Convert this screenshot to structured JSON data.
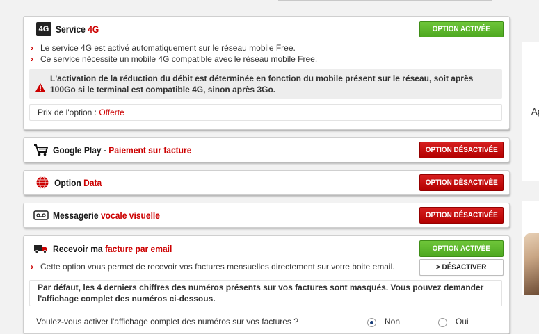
{
  "service4g": {
    "badge": "4G",
    "title_a": "Service ",
    "title_b": "4G",
    "status": "OPTION ACTIVÉE",
    "bullets": [
      "Le service 4G est activé automatiquement sur le réseau mobile Free.",
      "Ce service nécessite un mobile 4G compatible avec le réseau mobile Free."
    ],
    "warning": "L'activation de la réduction du débit est déterminée en fonction du mobile présent sur le réseau, soit après 100Go si le terminal est compatible 4G, sinon après 3Go.",
    "price_label": "Prix de l'option : ",
    "price_value": "Offerte"
  },
  "googleplay": {
    "title_a": "Google Play - ",
    "title_b": "Paiement sur facture",
    "status": "OPTION DÉSACTIVÉE"
  },
  "data_option": {
    "title_a": "Option ",
    "title_b": "Data",
    "status": "OPTION DÉSACTIVÉE"
  },
  "voicemail": {
    "title_a": "Messagerie ",
    "title_b": "vocale visuelle",
    "status": "OPTION DÉSACTIVÉE"
  },
  "email_invoice": {
    "title_a": "Recevoir ma ",
    "title_b": "facture par email",
    "status": "OPTION ACTIVÉE",
    "deactivate": "> DÉSACTIVER",
    "bullet": "Cette option vous permet de recevoir vos factures mensuelles directement sur votre boite email.",
    "info": "Par défaut, les 4 derniers chiffres des numéros présents sur vos factures sont masqués. Vous pouvez demander l'affichage complet des numéros ci-dessous.",
    "question": "Voulez-vous activer l'affichage complet des numéros sur vos factures ?",
    "option_no": "Non",
    "option_yes": "Oui"
  },
  "side": {
    "partial_text": "Ap"
  },
  "colors": {
    "accent_red": "#cc0000",
    "active_green": "#5cb82b",
    "inactive_red": "#c40000"
  }
}
